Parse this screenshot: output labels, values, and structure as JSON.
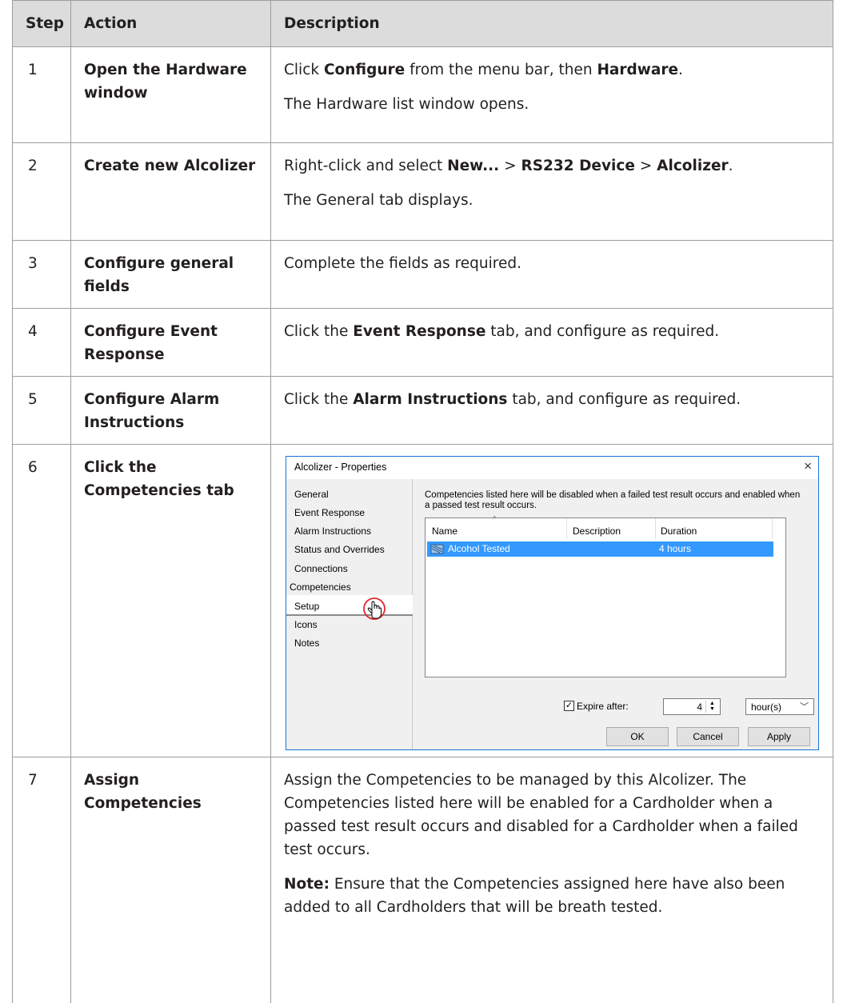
{
  "table": {
    "headers": {
      "step": "Step",
      "action": "Action",
      "description": "Description"
    },
    "rows": [
      {
        "step": "1",
        "action": "Open the Hardware window",
        "desc": [
          [
            {
              "t": "Click "
            },
            {
              "b": "Configure"
            },
            {
              "t": " from the menu bar, then "
            },
            {
              "b": "Hardware"
            },
            {
              "t": "."
            }
          ],
          [
            {
              "t": "The Hardware list window opens."
            }
          ]
        ]
      },
      {
        "step": "2",
        "action": "Create new Alcolizer",
        "desc": [
          [
            {
              "t": "Right-click and select "
            },
            {
              "b": "New..."
            },
            {
              "t": " > "
            },
            {
              "b": "RS232 Device"
            },
            {
              "t": " > "
            },
            {
              "b": "Alcolizer"
            },
            {
              "t": "."
            }
          ],
          [
            {
              "t": "The General tab displays."
            }
          ]
        ]
      },
      {
        "step": "3",
        "action": "Configure general fields",
        "desc": [
          [
            {
              "t": "Complete the fields as required."
            }
          ]
        ]
      },
      {
        "step": "4",
        "action": "Configure Event Response",
        "desc": [
          [
            {
              "t": "Click the "
            },
            {
              "b": "Event Response"
            },
            {
              "t": " tab, and configure as required."
            }
          ]
        ]
      },
      {
        "step": "5",
        "action": "Configure Alarm Instructions",
        "desc": [
          [
            {
              "t": "Click the "
            },
            {
              "b": "Alarm Instructions"
            },
            {
              "t": " tab, and configure as required."
            }
          ]
        ]
      },
      {
        "step": "6",
        "action": "Click the Competencies tab",
        "desc": []
      },
      {
        "step": "7",
        "action": "Assign Competencies",
        "desc": [
          [
            {
              "t": "Assign the Competencies to be managed by this Alcolizer. The Competencies listed here will be enabled for a Cardholder when a passed test result occurs and disabled for a Cardholder when a failed test occurs."
            }
          ],
          [
            {
              "b": "Note:"
            },
            {
              "t": " Ensure that the Competencies assigned here have also been added to all Cardholders that will be breath tested."
            }
          ]
        ]
      }
    ]
  },
  "dialog": {
    "title": "Alcolizer - Properties",
    "close_glyph": "×",
    "nav_items": [
      "General",
      "Event Response",
      "Alarm Instructions",
      "Status and Overrides",
      "Connections",
      "Competencies",
      "Setup",
      "Icons",
      "Notes"
    ],
    "selected_nav": "Competencies",
    "intro": "Competencies listed here will be disabled when a failed test result occurs and enabled when a passed test result occurs.",
    "list": {
      "columns": [
        "Name",
        "Description",
        "Duration"
      ],
      "rows": [
        {
          "name": "Alcohol Tested",
          "description": "",
          "duration": "4 hours",
          "selected": true
        }
      ]
    },
    "expire": {
      "checked": true,
      "label": "Expire after:",
      "value": "4",
      "unit": "hour(s)"
    },
    "buttons": {
      "ok": "OK",
      "cancel": "Cancel",
      "apply": "Apply"
    },
    "colors": {
      "accent": "#1874d2",
      "selection": "#3399ff",
      "cursor_ring": "#e0282e"
    }
  }
}
